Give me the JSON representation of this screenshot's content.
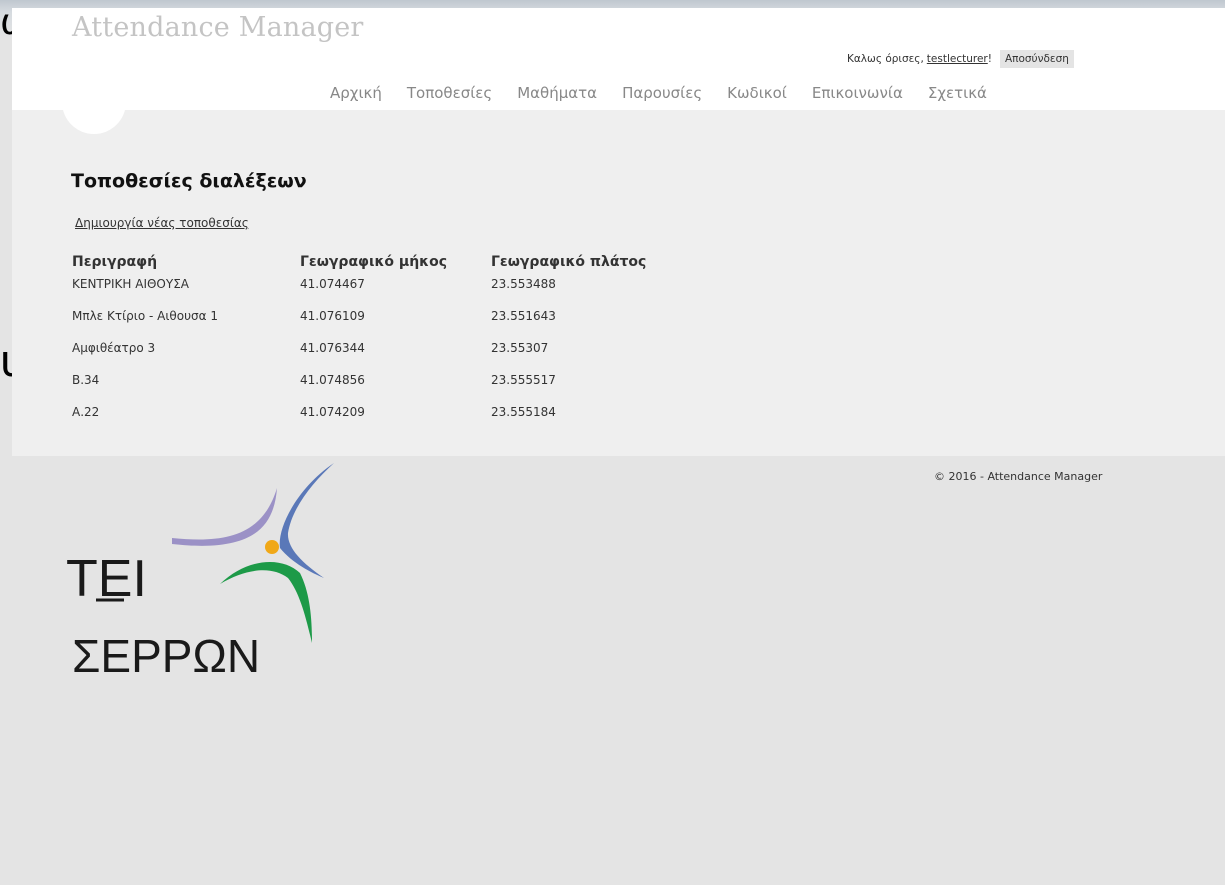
{
  "background": {
    "glyph_top": "ω",
    "glyph_mid": "υ"
  },
  "header": {
    "title": "Attendance Manager",
    "welcome_prefix": "Καλως όρισες,",
    "username": "testlecturer",
    "welcome_suffix": "!",
    "logout_label": "Αποσύνδεση",
    "nav": [
      "Αρχική",
      "Τοποθεσίες",
      "Μαθήματα",
      "Παρουσίες",
      "Κωδικοί",
      "Επικοινωνία",
      "Σχετικά"
    ]
  },
  "main": {
    "title": "Τοποθεσίες διαλέξεων",
    "create_link": "Δημιουργία νέας τοποθεσίας",
    "table": {
      "headers": [
        "Περιγραφή",
        "Γεωγραφικό μήκος",
        "Γεωγραφικό πλάτος"
      ],
      "rows": [
        [
          "ΚΕΝΤΡΙΚΗ ΑΙΘΟΥΣΑ",
          "41.074467",
          "23.553488"
        ],
        [
          "Μπλε Κτίριο - Αιθουσα 1",
          "41.076109",
          "23.551643"
        ],
        [
          "Αμφιθέατρο 3",
          "41.076344",
          "23.55307"
        ],
        [
          "Β.34",
          "41.074856",
          "23.555517"
        ],
        [
          "Α.22",
          "41.074209",
          "23.555184"
        ]
      ]
    }
  },
  "footer": {
    "copyright": "© 2016 - Attendance Manager",
    "logo": {
      "line1": "ΤΕΙ",
      "line2": "ΣΕΡΡΩΝ"
    }
  },
  "colors": {
    "logo_purple": "#9b91c6",
    "logo_blue": "#5a78b8",
    "logo_green": "#1d9a48",
    "logo_orange": "#f0a818"
  }
}
